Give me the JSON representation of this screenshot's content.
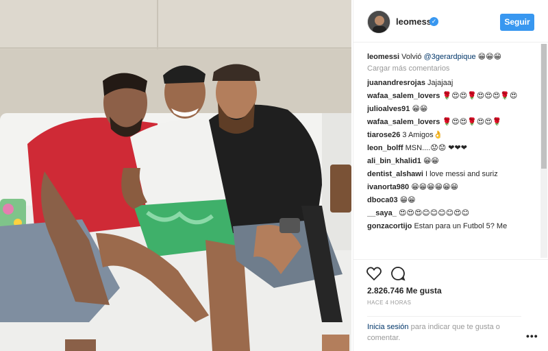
{
  "post": {
    "username": "leomessi",
    "follow_label": "Seguir",
    "caption_user": "leomessi",
    "caption_text": "Volvió",
    "caption_mention": "@3gerardpique",
    "caption_emoji": "😁😁😁",
    "load_more": "Cargar más comentarios",
    "likes": "2.826.746 Me gusta",
    "time_ago": "HACE 4 HORAS",
    "login_link": "Inicia sesión",
    "login_text": "para indicar que te gusta o comentar.",
    "more_label": "•••",
    "photo_alt": "photo-of-three-men-on-white-sofa"
  },
  "comments": [
    {
      "user": "juanandresrojas",
      "text": "Jajajaaj"
    },
    {
      "user": "wafaa_salem_lovers",
      "text": "🌹😍😍🌹😍😍😍🌹😍"
    },
    {
      "user": "julioalves91",
      "text": "😁😁"
    },
    {
      "user": "wafaa_salem_lovers",
      "text": "🌹😍😍🌹😍😍🌹"
    },
    {
      "user": "tiarose26",
      "text": "3 Amigos👌"
    },
    {
      "user": "leon_bolff",
      "text": "MSN....😟😟 ❤❤❤"
    },
    {
      "user": "ali_bin_khalid1",
      "text": "😁😁"
    },
    {
      "user": "dentist_alshawi",
      "text": "I love messi and suriz"
    },
    {
      "user": "ivanorta980",
      "text": "😁😁😁😁😁😁"
    },
    {
      "user": "dboca03",
      "text": "😁😁"
    },
    {
      "user": "__saya_",
      "text": "😍😍😍😊😊😊😊😍😊"
    },
    {
      "user": "gonzacortijo",
      "text": "Estan para un Futbol 5? Me"
    }
  ],
  "colors": {
    "accent": "#3897f0",
    "link": "#003569",
    "muted": "#999999",
    "text": "#262626"
  },
  "icons": {
    "verified": "verified-badge-icon",
    "like": "heart-icon",
    "comment": "comment-bubble-icon",
    "more": "more-dots-icon"
  }
}
